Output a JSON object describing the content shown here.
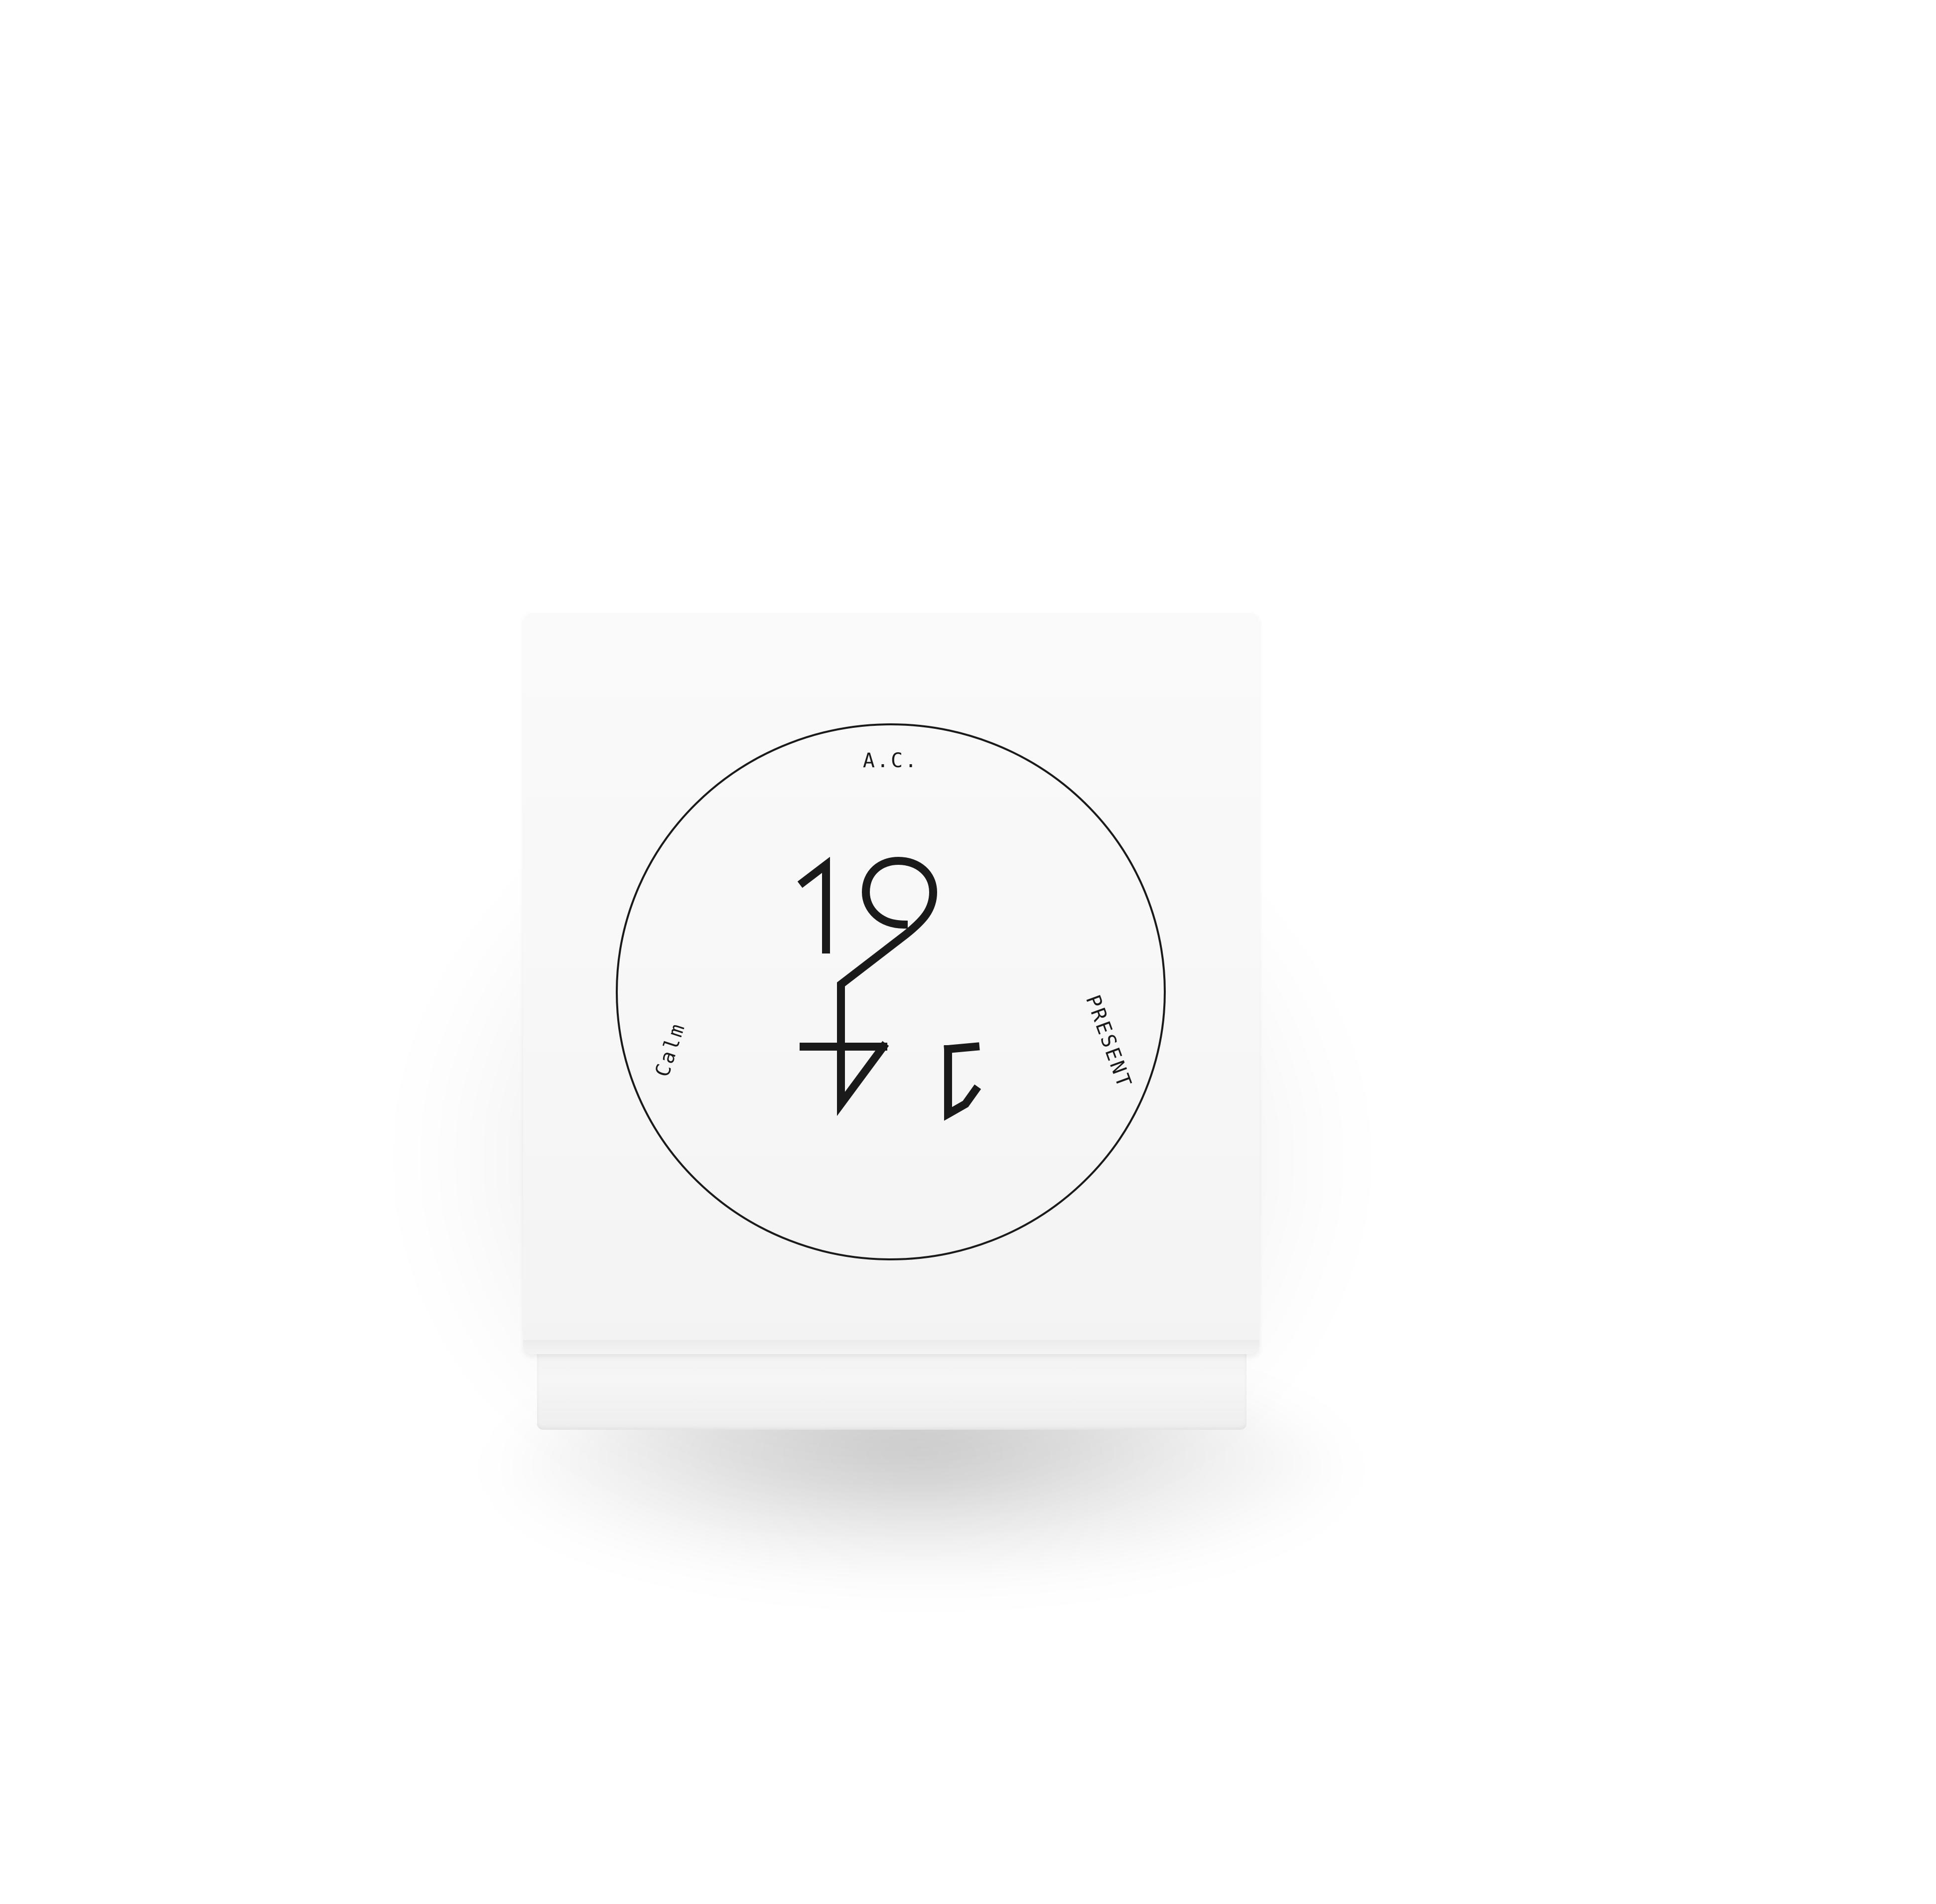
{
  "product": {
    "top_text": "A.C.",
    "logo_top": "19",
    "logo_bottom": "14",
    "left_text": "Calm",
    "right_text": "PRESENT"
  },
  "colors": {
    "background": "#ffffff",
    "box": "#f7f7f7",
    "ink": "#1a1a1a"
  }
}
